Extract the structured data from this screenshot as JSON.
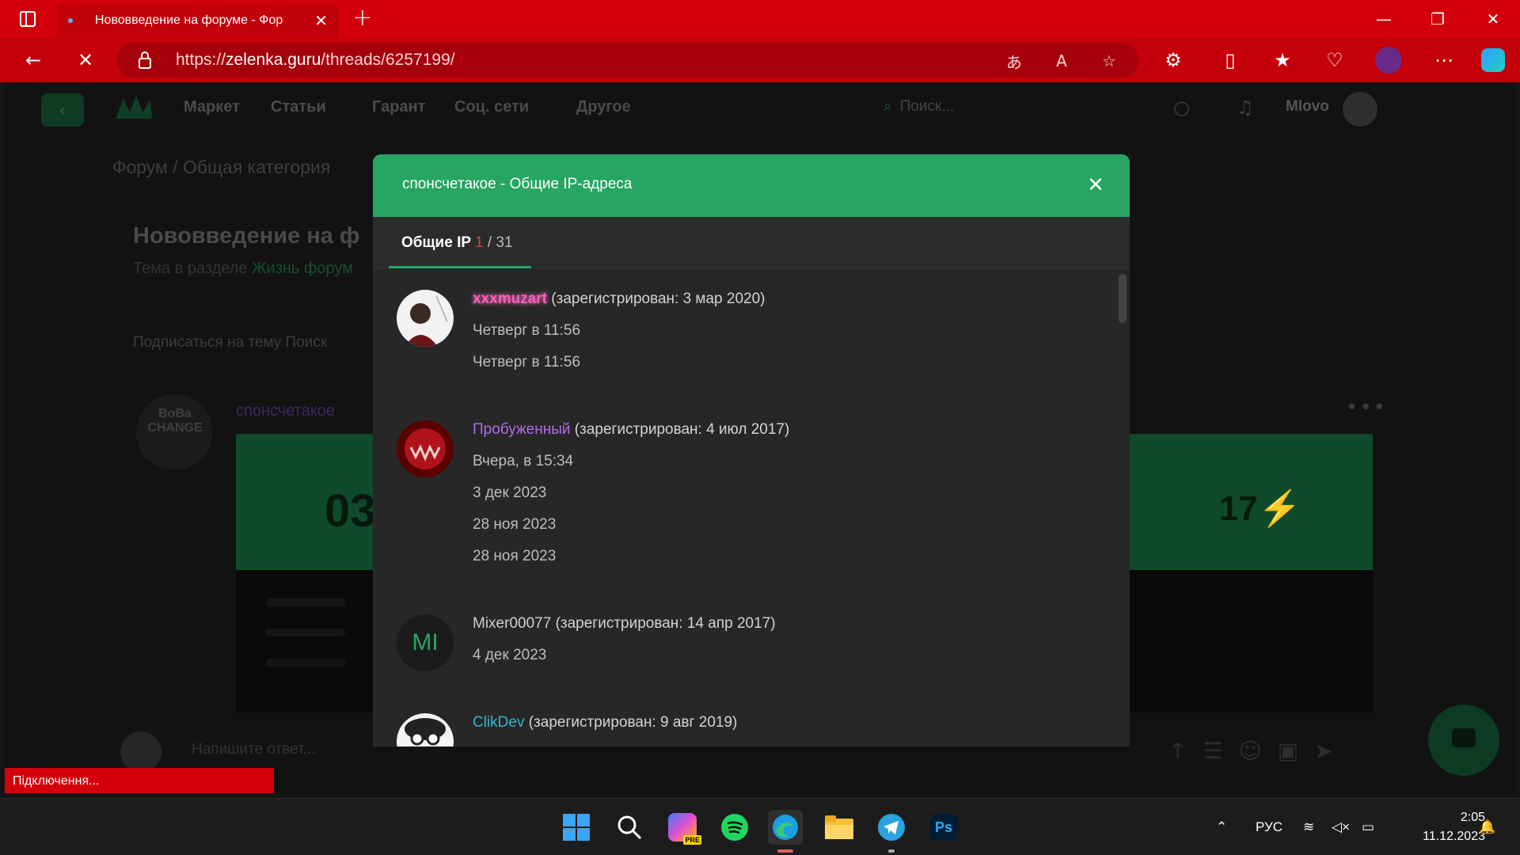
{
  "browser": {
    "tab_title": "Нововведение на форуме - Фор",
    "url_prefix": "https://",
    "url_domain": "zelenka.guru",
    "url_path": "/threads/6257199/",
    "new_tab_symbol": "+",
    "accent_color": "#d3000c"
  },
  "site": {
    "nav": {
      "links": [
        "Маркет",
        "Статьи",
        "Гарант",
        "Соц. сети",
        "Другое"
      ],
      "search_placeholder": "Поиск...",
      "username": "Mlovo"
    },
    "breadcrumb": "Форум / Общая категория",
    "thread_title": "Нововведение на ф",
    "thread_subtitle_prefix": "Тема в разделе ",
    "thread_subtitle_link": "Жизнь форум",
    "thread_actions": "Подписаться на тему   Поиск",
    "post_author": "спонсчетакое",
    "avatar_text": "BoBa CHANGE",
    "banner_left": "03",
    "banner_right": "17⚡",
    "reply_placeholder": "Напишите ответ..."
  },
  "status_toast": "Підключення...",
  "modal": {
    "title": "спонсчетакое - Общие IP-адреса",
    "tab": {
      "label": "Общие IP",
      "current": "1",
      "total": "/ 31"
    },
    "accent_color": "#27a563",
    "entries": [
      {
        "username": "xxxmuzart",
        "registered": "(зарегистрирован: 3 мар 2020)",
        "dates": [
          "Четверг в 11:56",
          "Четверг в 11:56"
        ]
      },
      {
        "username": "Пробуженный",
        "registered": "(зарегистрирован: 4 июл 2017)",
        "dates": [
          "Вчера, в 15:34",
          "3 дек 2023",
          "28 ноя 2023",
          "28 ноя 2023"
        ]
      },
      {
        "username": "Mixer00077",
        "avatar_initials": "MI",
        "registered": "(зарегистрирован: 14 апр 2017)",
        "dates": [
          "4 дек 2023"
        ]
      },
      {
        "username": "ClikDev",
        "registered": "(зарегистрирован: 9 авг 2019)",
        "dates": []
      }
    ]
  },
  "taskbar": {
    "language": "РУС",
    "time": "2:05",
    "date": "11.12.2023",
    "apps": [
      "windows-start",
      "search",
      "copilot-pre",
      "spotify",
      "edge",
      "file-explorer",
      "telegram",
      "photoshop"
    ],
    "photoshop_label": "Ps",
    "copilot_badge": "PRE"
  }
}
